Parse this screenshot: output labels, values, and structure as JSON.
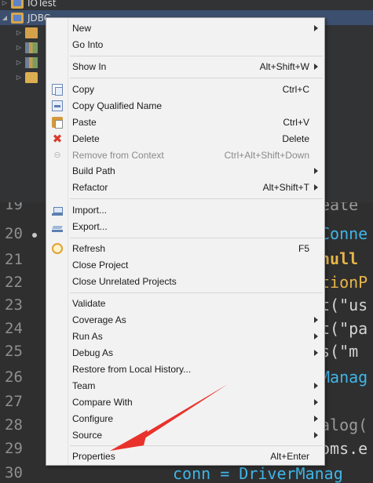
{
  "explorer": {
    "rows": [
      {
        "label": "IOTest"
      },
      {
        "label": "JDBC"
      }
    ]
  },
  "editor": {
    "line_numbers": [
      "19",
      "20",
      "21",
      "22",
      "23",
      "24",
      "25",
      "26",
      "27",
      "28",
      "29",
      "30"
    ],
    "right_fragments": [
      "eate",
      "Conne",
      "null",
      "tionP",
      "t(\"us",
      "t(\"pa",
      "s(\"m",
      "Manag",
      "",
      "alog(",
      "oms.e",
      ""
    ],
    "last_line": "conn = DriverManag"
  },
  "menu": {
    "items": [
      {
        "label": "New",
        "accel": "",
        "submenu": true
      },
      {
        "label": "Go Into",
        "accel": "",
        "submenu": false
      },
      {
        "label": "Show In",
        "accel": "Alt+Shift+W",
        "submenu": true
      },
      {
        "label": "Copy",
        "accel": "Ctrl+C",
        "submenu": false,
        "icon": "copy-icon"
      },
      {
        "label": "Copy Qualified Name",
        "accel": "",
        "submenu": false,
        "icon": "copy-qualified-name-icon"
      },
      {
        "label": "Paste",
        "accel": "Ctrl+V",
        "submenu": false,
        "icon": "paste-icon"
      },
      {
        "label": "Delete",
        "accel": "Delete",
        "submenu": false,
        "icon": "delete-icon"
      },
      {
        "label": "Remove from Context",
        "accel": "Ctrl+Alt+Shift+Down",
        "submenu": false,
        "icon": "remove-context-icon",
        "disabled": true
      },
      {
        "label": "Build Path",
        "accel": "",
        "submenu": true
      },
      {
        "label": "Refactor",
        "accel": "Alt+Shift+T",
        "submenu": true
      },
      {
        "label": "Import...",
        "accel": "",
        "submenu": false,
        "icon": "import-icon"
      },
      {
        "label": "Export...",
        "accel": "",
        "submenu": false,
        "icon": "export-icon"
      },
      {
        "label": "Refresh",
        "accel": "F5",
        "submenu": false,
        "icon": "refresh-icon"
      },
      {
        "label": "Close Project",
        "accel": "",
        "submenu": false
      },
      {
        "label": "Close Unrelated Projects",
        "accel": "",
        "submenu": false
      },
      {
        "label": "Validate",
        "accel": "",
        "submenu": false
      },
      {
        "label": "Coverage As",
        "accel": "",
        "submenu": true
      },
      {
        "label": "Run As",
        "accel": "",
        "submenu": true
      },
      {
        "label": "Debug As",
        "accel": "",
        "submenu": true
      },
      {
        "label": "Restore from Local History...",
        "accel": "",
        "submenu": false
      },
      {
        "label": "Team",
        "accel": "",
        "submenu": true
      },
      {
        "label": "Compare With",
        "accel": "",
        "submenu": true
      },
      {
        "label": "Configure",
        "accel": "",
        "submenu": true
      },
      {
        "label": "Source",
        "accel": "",
        "submenu": true
      },
      {
        "label": "Properties",
        "accel": "Alt+Enter",
        "submenu": false
      }
    ]
  },
  "colors": {
    "annotation_arrow": "#e8322b",
    "menu_background": "#f2f2f2",
    "editor_keyword": "#e8b64a",
    "editor_type": "#3fb5e8"
  }
}
